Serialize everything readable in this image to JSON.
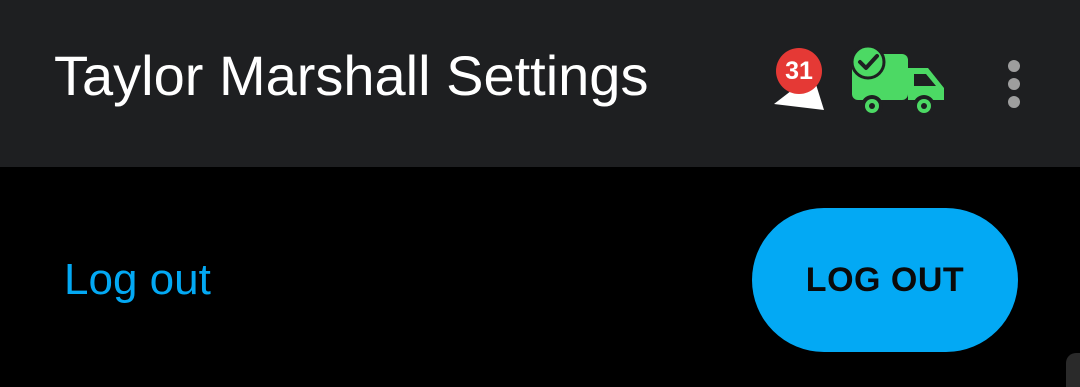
{
  "app_bar": {
    "title": "Taylor Marshall Settings",
    "notification_count": "31",
    "notifications_icon": "bell-icon",
    "delivery_icon": "delivery-truck-check-icon",
    "more_icon": "more-vert-icon",
    "colors": {
      "background": "#1e1f21",
      "badge": "#e53935",
      "truck": "#4cd964"
    }
  },
  "content": {
    "row_label": "Log out",
    "button_label": "LOG OUT",
    "colors": {
      "accent": "#03a9f4"
    }
  }
}
